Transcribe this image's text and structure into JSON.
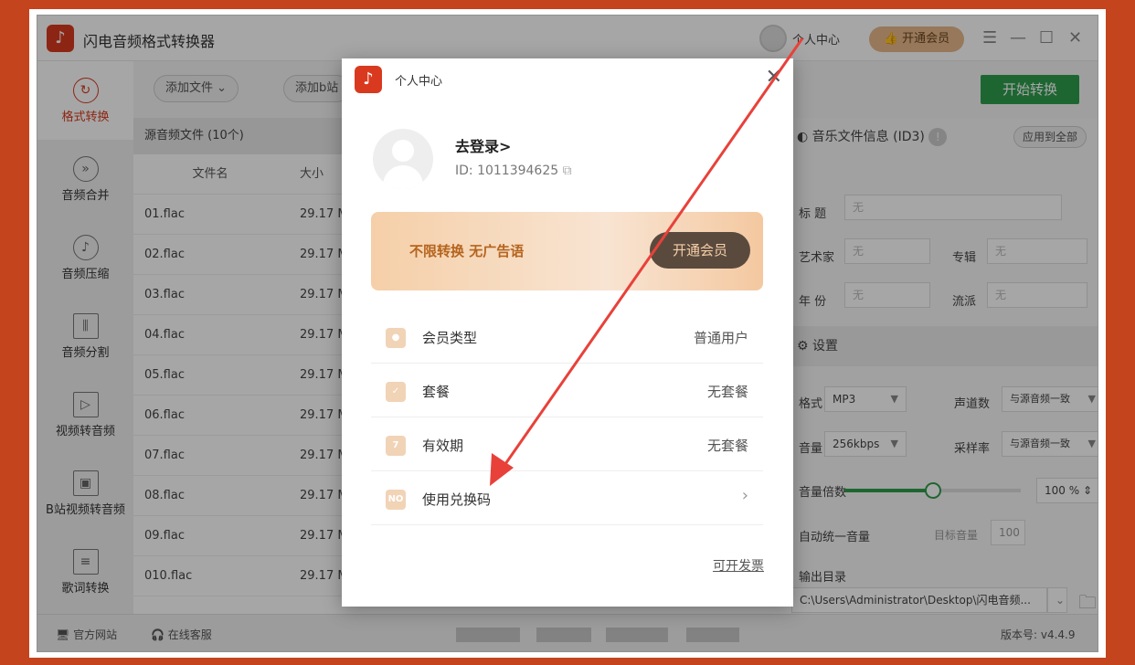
{
  "app": {
    "title": "闪电音频格式转换器",
    "user_center": "个人中心",
    "vip_button": "开通会员"
  },
  "sidebar": {
    "items": [
      {
        "label": "格式转换",
        "icon": "refresh-icon"
      },
      {
        "label": "音频合并",
        "icon": "merge-icon"
      },
      {
        "label": "音频压缩",
        "icon": "music-note-icon"
      },
      {
        "label": "音频分割",
        "icon": "split-icon"
      },
      {
        "label": "视频转音频",
        "icon": "video-icon"
      },
      {
        "label": "B站视频转音频",
        "icon": "bilibili-icon"
      },
      {
        "label": "歌词转换",
        "icon": "lyrics-icon"
      }
    ]
  },
  "toolbar": {
    "add_file": "添加文件",
    "add_bilibili": "添加b站",
    "start_convert": "开始转换"
  },
  "file_list": {
    "header": "源音频文件 (10个)",
    "columns": [
      "文件名",
      "大小"
    ],
    "rows": [
      {
        "name": "01.flac",
        "size": "29.17 M"
      },
      {
        "name": "02.flac",
        "size": "29.17 M"
      },
      {
        "name": "03.flac",
        "size": "29.17 M"
      },
      {
        "name": "04.flac",
        "size": "29.17 M"
      },
      {
        "name": "05.flac",
        "size": "29.17 M"
      },
      {
        "name": "06.flac",
        "size": "29.17 M"
      },
      {
        "name": "07.flac",
        "size": "29.17 M"
      },
      {
        "name": "08.flac",
        "size": "29.17 M"
      },
      {
        "name": "09.flac",
        "size": "29.17 M"
      },
      {
        "name": "010.flac",
        "size": "29.17 M"
      }
    ]
  },
  "info_panel": {
    "title": "音乐文件信息 (ID3)",
    "apply_all": "应用到全部",
    "title_label": "标 题",
    "artist_label": "艺术家",
    "album_label": "专辑",
    "year_label": "年 份",
    "genre_label": "流派",
    "empty_value": "无"
  },
  "settings": {
    "section_title": "设置",
    "format_label": "格式",
    "format_value": "MP3",
    "channels_label": "声道数",
    "channels_value": "与源音频一致",
    "bitrate_label": "音量",
    "bitrate_value": "256kbps",
    "samplerate_label": "采样率",
    "samplerate_value": "与源音频一致",
    "volume_label": "音量倍数",
    "volume_value": "100",
    "volume_unit": "%",
    "volume_fraction": 0.5,
    "auto_volume_label": "自动统一音量",
    "target_volume_label": "目标音量",
    "target_volume_value": "100",
    "output_label": "输出目录",
    "output_path": "C:\\Users\\Administrator\\Desktop\\闪电音频..."
  },
  "status": {
    "website": "官方网站",
    "support": "在线客服",
    "version": "版本号: v4.4.9"
  },
  "modal": {
    "title": "个人中心",
    "login": "去登录>",
    "user_id": "ID: 1011394625",
    "banner_text": "不限转换 无广告语",
    "banner_button": "开通会员",
    "rows": [
      {
        "label": "会员类型",
        "value": "普通用户"
      },
      {
        "label": "套餐",
        "value": "无套餐"
      },
      {
        "label": "有效期",
        "value": "无套餐"
      },
      {
        "label": "使用兑换码",
        "value": "›"
      }
    ],
    "invoice": "可开发票"
  },
  "colors": {
    "background": "#c4441e",
    "accent": "#d93a1f",
    "green": "#2e9d4c",
    "arrow": "#e8413a"
  }
}
